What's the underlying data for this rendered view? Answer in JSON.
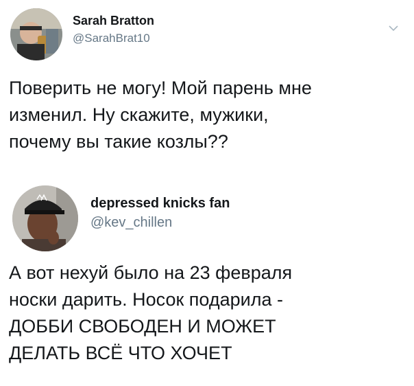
{
  "tweets": [
    {
      "author": {
        "name": "Sarah Bratton",
        "handle": "@SarahBrat10",
        "avatar_icon": "avatar-photo"
      },
      "menu_icon": "chevron-down-icon",
      "text_lines": [
        "Поверить не могу! Мой парень мне",
        "изменил. Ну скажите, мужики,",
        "почему вы такие козлы??"
      ]
    },
    {
      "author": {
        "name": "depressed knicks fan",
        "handle": "@kev_chillen",
        "avatar_icon": "avatar-photo"
      },
      "text_lines": [
        "А вот нехуй было на 23 февраля",
        "носки дарить. Носок подарила -",
        "ДОББИ СВОБОДЕН И МОЖЕТ",
        "ДЕЛАТЬ ВСЁ ЧТО ХОЧЕТ"
      ]
    }
  ],
  "colors": {
    "text": "#14171a",
    "secondary": "#657786",
    "chevron": "#aab8c2"
  }
}
